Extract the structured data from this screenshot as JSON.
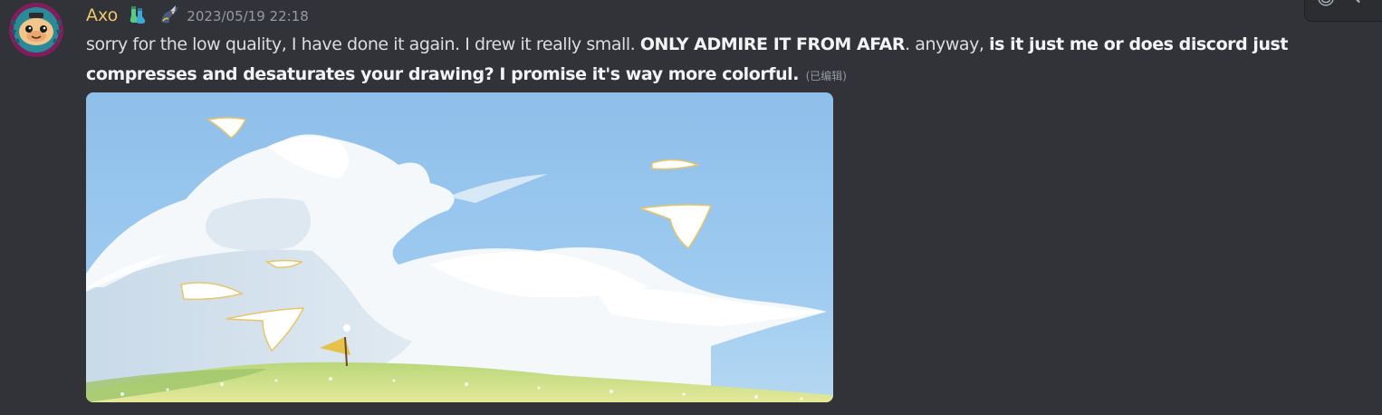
{
  "message": {
    "username": "Axo",
    "username_color": "#f0c96a",
    "badges": [
      "socks-emoji-badge",
      "dragon-emoji-badge"
    ],
    "timestamp": "2023/05/19 22:18",
    "text": {
      "part1": "sorry for the low quality, I have done it again. I drew it really small. ",
      "bold1": "ONLY ADMIRE IT FROM AFAR",
      "part2": ". anyway, ",
      "bold2": "is it just me or does discord just compresses and desaturates your drawing? I promise it's way more colorful.",
      "edited": "(已编辑)"
    },
    "attachment": {
      "type": "image",
      "subject": "sky-clouds-painting"
    }
  },
  "theme": {
    "background": "#313338",
    "text": "#dbdee1",
    "muted": "#949ba4"
  }
}
